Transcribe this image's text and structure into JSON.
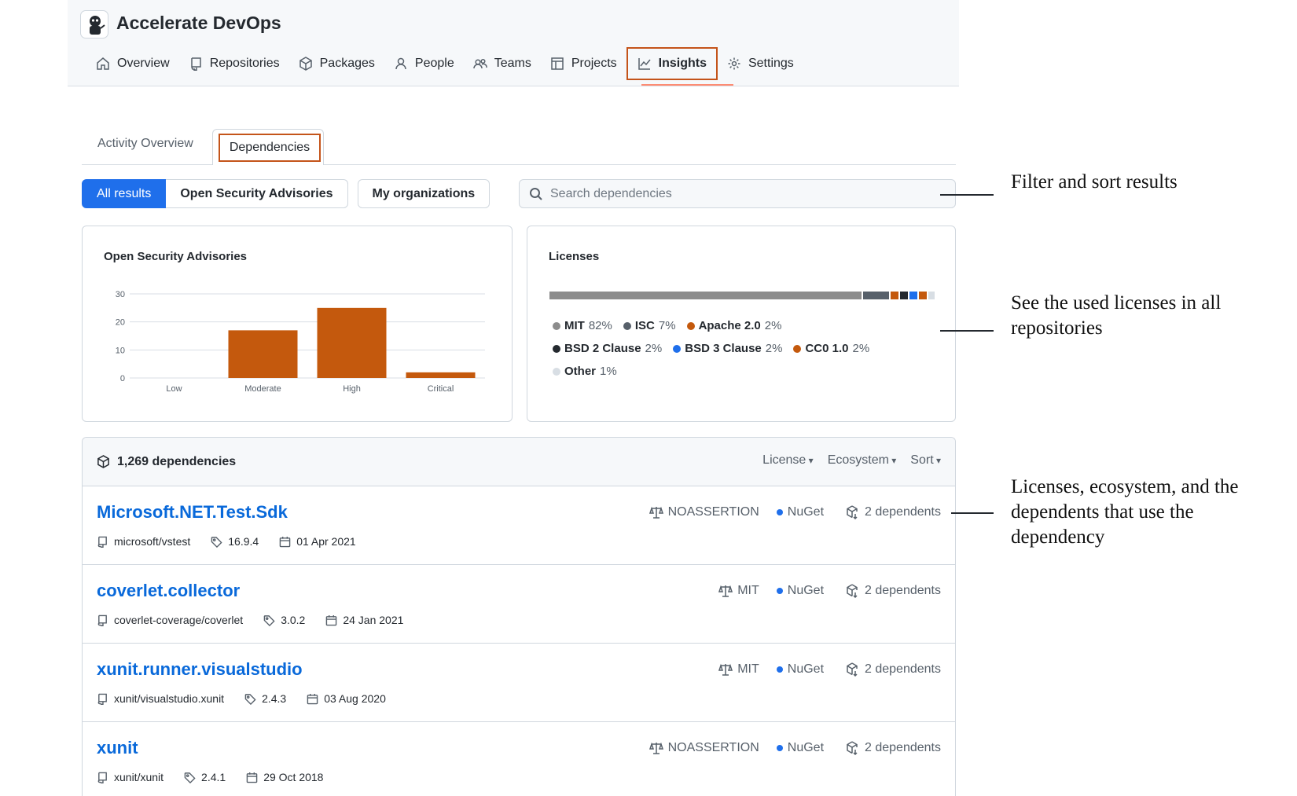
{
  "org": {
    "name": "Accelerate DevOps"
  },
  "nav": [
    {
      "label": "Overview",
      "icon": "home-icon"
    },
    {
      "label": "Repositories",
      "icon": "repo-icon"
    },
    {
      "label": "Packages",
      "icon": "package-icon"
    },
    {
      "label": "People",
      "icon": "person-icon"
    },
    {
      "label": "Teams",
      "icon": "people-icon"
    },
    {
      "label": "Projects",
      "icon": "table-icon"
    },
    {
      "label": "Insights",
      "icon": "graph-icon",
      "active": true
    },
    {
      "label": "Settings",
      "icon": "gear-icon"
    }
  ],
  "subtabs": {
    "activity": "Activity Overview",
    "dependencies": "Dependencies"
  },
  "filters": {
    "all": "All results",
    "advisories": "Open Security Advisories",
    "my_orgs": "My organizations"
  },
  "search": {
    "placeholder": "Search dependencies"
  },
  "advisories_panel": {
    "title": "Open Security Advisories"
  },
  "chart_data": {
    "type": "bar",
    "title": "Open Security Advisories",
    "categories": [
      "Low",
      "Moderate",
      "High",
      "Critical"
    ],
    "values": [
      0,
      17,
      25,
      2
    ],
    "ylim": [
      0,
      30
    ],
    "yticks": [
      0,
      10,
      20,
      30
    ],
    "grid": true,
    "color": "#c4590d"
  },
  "licenses_panel": {
    "title": "Licenses",
    "rows": [
      [
        {
          "name": "MIT",
          "pct": "82%",
          "color": "#8c8c8c"
        },
        {
          "name": "ISC",
          "pct": "7%",
          "color": "#57606a"
        },
        {
          "name": "Apache 2.0",
          "pct": "2%",
          "color": "#c4590d"
        }
      ],
      [
        {
          "name": "BSD 2 Clause",
          "pct": "2%",
          "color": "#24292f"
        },
        {
          "name": "BSD 3 Clause",
          "pct": "2%",
          "color": "#1f6feb"
        },
        {
          "name": "CC0 1.0",
          "pct": "2%",
          "color": "#c4590d"
        }
      ],
      [
        {
          "name": "Other",
          "pct": "1%",
          "color": "#d8dee4"
        }
      ]
    ]
  },
  "deps": {
    "count": "1,269 dependencies",
    "sort": {
      "license": "License",
      "ecosystem": "Ecosystem",
      "sort": "Sort"
    },
    "items": [
      {
        "name": "Microsoft.NET.Test.Sdk",
        "repo": "microsoft/vstest",
        "version": "16.9.4",
        "date": "01 Apr 2021",
        "license": "NOASSERTION",
        "ecosystem": "NuGet",
        "dependents": "2 dependents"
      },
      {
        "name": "coverlet.collector",
        "repo": "coverlet-coverage/coverlet",
        "version": "3.0.2",
        "date": "24 Jan 2021",
        "license": "MIT",
        "ecosystem": "NuGet",
        "dependents": "2 dependents"
      },
      {
        "name": "xunit.runner.visualstudio",
        "repo": "xunit/visualstudio.xunit",
        "version": "2.4.3",
        "date": "03 Aug 2020",
        "license": "MIT",
        "ecosystem": "NuGet",
        "dependents": "2 dependents"
      },
      {
        "name": "xunit",
        "repo": "xunit/xunit",
        "version": "2.4.1",
        "date": "29 Oct 2018",
        "license": "NOASSERTION",
        "ecosystem": "NuGet",
        "dependents": "2 dependents"
      }
    ]
  },
  "annotations": {
    "filter": "Filter and sort results",
    "licenses": "See the used licenses in all repositories",
    "dependents": "Licenses, ecosystem, and the dependents that use the dependency"
  }
}
